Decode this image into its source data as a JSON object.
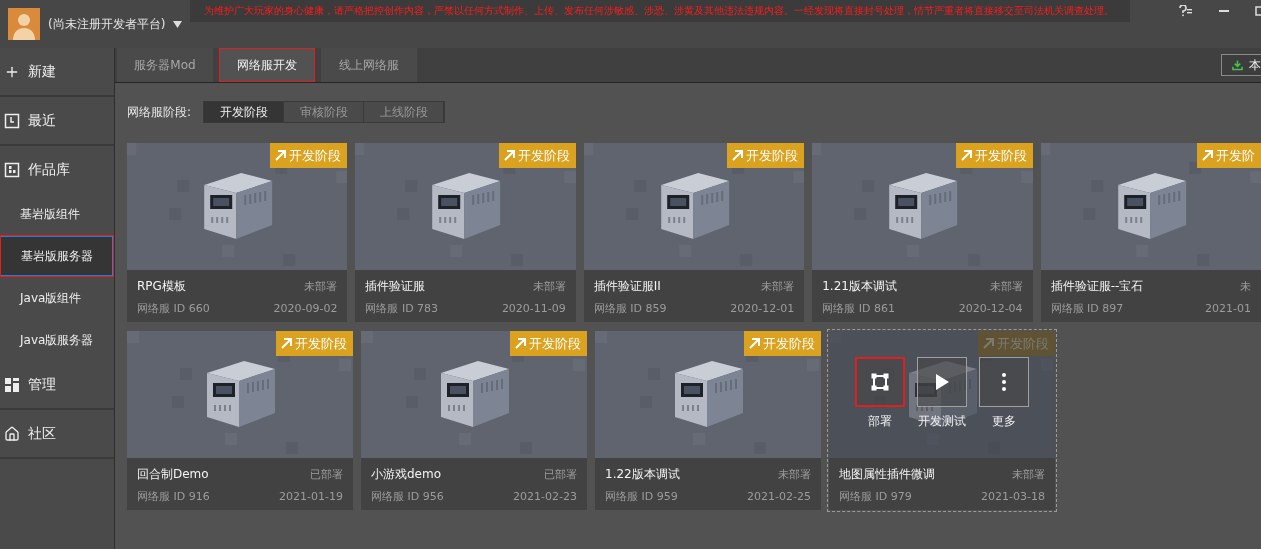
{
  "account": {
    "name": "(尚未注册开发者平台)"
  },
  "notice": "为维护广大玩家的身心健康，请严格把控创作内容，严禁以任何方式制作、上传、发布任何涉敏感、涉恐、涉黄及其他违法违规内容。一经发现将直接封号处理，情节严重者将直接移交至司法机关调查处理。",
  "sidebar": {
    "items": [
      {
        "label": "新建",
        "kind": "new"
      },
      {
        "label": "最近",
        "kind": "recent"
      },
      {
        "label": "作品库",
        "kind": "library",
        "children": [
          {
            "label": "基岩版组件",
            "selected": false,
            "highlighted": false
          },
          {
            "label": "基岩版服务器",
            "selected": true,
            "highlighted": true
          },
          {
            "label": "Java版组件",
            "selected": false,
            "highlighted": false
          },
          {
            "label": "Java版服务器",
            "selected": false,
            "highlighted": false
          }
        ]
      },
      {
        "label": "管理",
        "kind": "manage"
      },
      {
        "label": "社区",
        "kind": "community"
      }
    ]
  },
  "tabs": [
    {
      "label": "服务器Mod",
      "selected": false,
      "highlighted": false
    },
    {
      "label": "网络服开发",
      "selected": true,
      "highlighted": true
    },
    {
      "label": "线上网络服",
      "selected": false,
      "highlighted": false
    }
  ],
  "toolbar_button": {
    "label": "本"
  },
  "stage_filter": {
    "label": "网络服阶段:",
    "options": [
      {
        "label": "开发阶段",
        "selected": true
      },
      {
        "label": "审核阶段",
        "selected": false
      },
      {
        "label": "上线阶段",
        "selected": false
      }
    ]
  },
  "card_rows": [
    {
      "cards": [
        {
          "title": "RPG模板",
          "status": "未部署",
          "server_id": "网络服 ID 660",
          "date": "2020-09-02",
          "badge": "开发阶段",
          "hovered": false
        },
        {
          "title": "插件验证服",
          "status": "未部署",
          "server_id": "网络服 ID 783",
          "date": "2020-11-09",
          "badge": "开发阶段",
          "hovered": false
        },
        {
          "title": "插件验证服II",
          "status": "未部署",
          "server_id": "网络服 ID 859",
          "date": "2020-12-01",
          "badge": "开发阶段",
          "hovered": false
        },
        {
          "title": "1.21版本调试",
          "status": "未部署",
          "server_id": "网络服 ID 861",
          "date": "2020-12-04",
          "badge": "开发阶段",
          "hovered": false
        },
        {
          "title": "插件验证服--宝石",
          "status": "未",
          "server_id": "网络服 ID 897",
          "date": "2021-01",
          "badge": "开发阶",
          "hovered": false
        }
      ]
    },
    {
      "cards": [
        {
          "title": "回合制Demo",
          "status": "已部署",
          "server_id": "网络服 ID 916",
          "date": "2021-01-19",
          "badge": "开发阶段",
          "hovered": false
        },
        {
          "title": "小游戏demo",
          "status": "已部署",
          "server_id": "网络服 ID 956",
          "date": "2021-02-23",
          "badge": "开发阶段",
          "hovered": false
        },
        {
          "title": "1.22版本调试",
          "status": "未部署",
          "server_id": "网络服 ID 959",
          "date": "2021-02-25",
          "badge": "开发阶段",
          "hovered": false
        },
        {
          "title": "地图属性插件微调",
          "status": "未部署",
          "server_id": "网络服 ID 979",
          "date": "2021-03-18",
          "badge": "开发阶段",
          "hovered": true,
          "actions": [
            {
              "label": "部署",
              "kind": "deploy",
              "highlighted": true
            },
            {
              "label": "开发测试",
              "kind": "test",
              "highlighted": false
            },
            {
              "label": "更多",
              "kind": "more",
              "highlighted": false
            }
          ]
        }
      ]
    }
  ]
}
